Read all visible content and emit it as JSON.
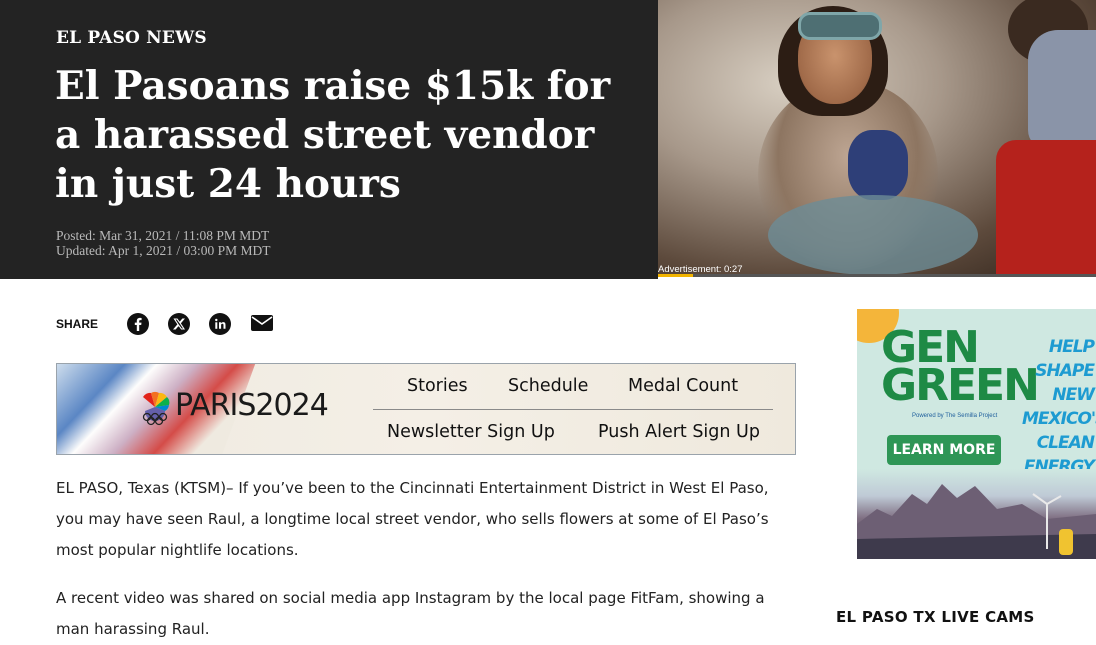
{
  "header": {
    "section": "EL PASO NEWS",
    "headline": "El Pasoans raise $15k for a harassed street vendor in just 24 hours",
    "posted": "Posted: Mar 31, 2021 / 11:08 PM MDT",
    "updated": "Updated: Apr 1, 2021 / 03:00 PM MDT"
  },
  "video": {
    "ad_label": "Advertisement: 0:27",
    "progress_fraction": 0.08
  },
  "share": {
    "label": "SHARE",
    "icons": [
      "facebook-icon",
      "x-icon",
      "linkedin-icon",
      "email-icon"
    ]
  },
  "olympics_banner": {
    "logo": "PARIS2024",
    "links": [
      "Stories",
      "Schedule",
      "Medal Count",
      "Newsletter Sign Up",
      "Push Alert Sign Up"
    ]
  },
  "article": {
    "paragraphs": [
      "EL PASO, Texas (KTSM)– If you’ve been to the Cincinnati Entertainment District in West El Paso, you may have seen Raul, a longtime local street vendor, who sells flowers at some of El Paso’s most popular nightlife locations.",
      "A recent video was shared on social media app Instagram by the local page FitFam, showing a man harassing Raul."
    ]
  },
  "sidebar_ad": {
    "brand": "GEN GREEN",
    "powered_by": "Powered by The Semilla Project",
    "cta": "LEARN MORE",
    "tagline": "HELP SHAPE NEW MEXICO'S CLEAN ENERGY FUTURE WORKFORCE"
  },
  "sidebar": {
    "live_cams_title": "EL PASO TX LIVE CAMS"
  },
  "colors": {
    "hero_bg": "#232323",
    "brand_green": "#2e9656",
    "ad_blue": "#1d9bd1"
  }
}
